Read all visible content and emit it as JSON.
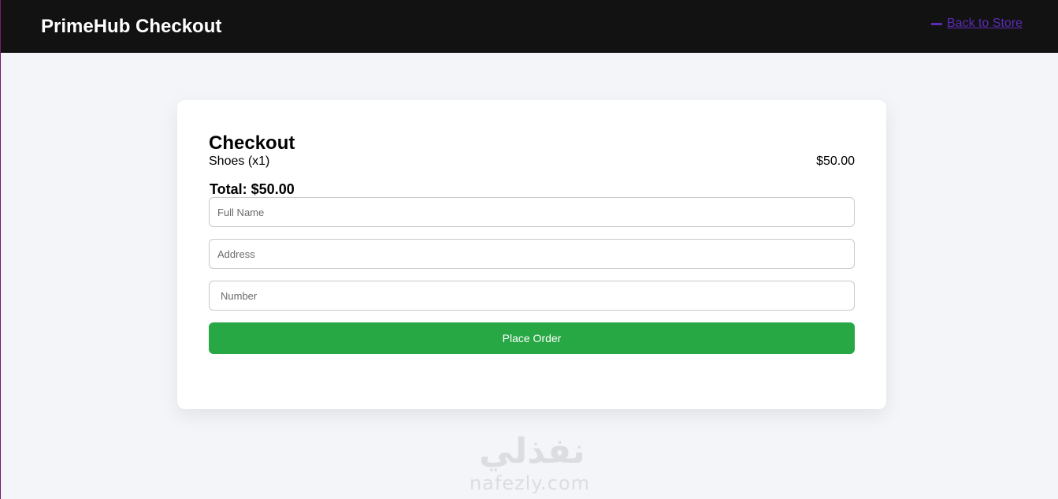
{
  "header": {
    "brand": "PrimeHub Checkout",
    "back_link": "Back to Store",
    "back_icon": "arrow-left-icon"
  },
  "checkout": {
    "title": "Checkout",
    "items": [
      {
        "name": "Shoes (x1)",
        "price": "$50.00"
      }
    ],
    "total": "Total: $50.00",
    "fields": {
      "full_name": {
        "placeholder": "Full Name",
        "value": ""
      },
      "address": {
        "placeholder": "Address",
        "value": ""
      },
      "number": {
        "placeholder": "Number",
        "value": ""
      }
    },
    "submit_label": "Place Order"
  },
  "watermark": {
    "arabic": "نفذلي",
    "latin": "nafezly.com"
  },
  "colors": {
    "header_bg": "#121212",
    "page_bg": "#f3f5f8",
    "link": "#5b2bb5",
    "primary_button": "#28a745"
  }
}
